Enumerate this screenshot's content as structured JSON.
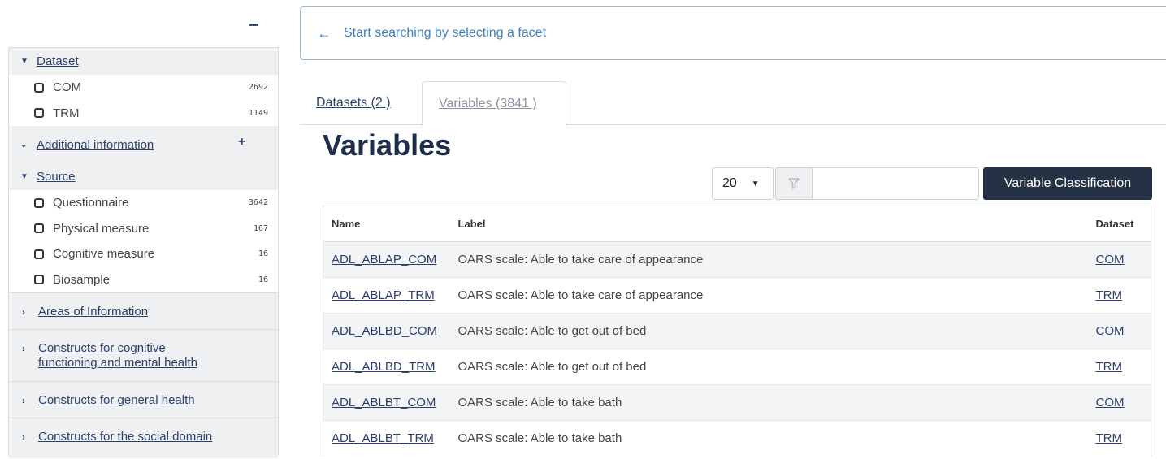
{
  "sidebar": {
    "collapse_symbol": "−",
    "sections": {
      "dataset": {
        "title": "Dataset",
        "items": [
          {
            "label": "COM",
            "count": "2692"
          },
          {
            "label": "TRM",
            "count": "1149"
          }
        ]
      },
      "additional_info": {
        "title": "Additional information",
        "plus": "+"
      },
      "source": {
        "title": "Source",
        "items": [
          {
            "label": "Questionnaire",
            "count": "3642"
          },
          {
            "label": "Physical measure",
            "count": "167"
          },
          {
            "label": "Cognitive measure",
            "count": "16"
          },
          {
            "label": "Biosample",
            "count": "16"
          }
        ]
      },
      "collapsed": [
        {
          "title": "Areas of Information"
        },
        {
          "title_line1": "Constructs for cognitive",
          "title_line2": "functioning and mental health"
        },
        {
          "title": "Constructs for general health"
        },
        {
          "title": "Constructs for the social domain"
        }
      ]
    }
  },
  "info_bar": {
    "text": "Start searching by selecting a facet"
  },
  "tabs": [
    {
      "label": "Datasets (2 )"
    },
    {
      "label": "Variables (3841 )"
    }
  ],
  "main": {
    "title": "Variables",
    "page_size": "20",
    "filter_placeholder": "",
    "classification_button": "Variable Classification",
    "table": {
      "headers": {
        "name": "Name",
        "label": "Label",
        "dataset": "Dataset"
      },
      "rows": [
        {
          "name": "ADL_ABLAP_COM",
          "label": "OARS scale: Able to take care of appearance",
          "dataset": "COM"
        },
        {
          "name": "ADL_ABLAP_TRM",
          "label": "OARS scale: Able to take care of appearance",
          "dataset": "TRM"
        },
        {
          "name": "ADL_ABLBD_COM",
          "label": "OARS scale: Able to get out of bed",
          "dataset": "COM"
        },
        {
          "name": "ADL_ABLBD_TRM",
          "label": "OARS scale: Able to get out of bed",
          "dataset": "TRM"
        },
        {
          "name": "ADL_ABLBT_COM",
          "label": "OARS scale: Able to take bath",
          "dataset": "COM"
        },
        {
          "name": "ADL_ABLBT_TRM",
          "label": "OARS scale: Able to take bath",
          "dataset": "TRM"
        }
      ]
    }
  },
  "icons": {
    "collapse": "minus-icon",
    "expanded_caret": "caret-down-icon",
    "collapsed_caret": "chevron-right-icon",
    "info_arrow": "arrow-left-icon",
    "filter": "filter-icon",
    "dropdown": "caret-down-icon"
  },
  "colors": {
    "primary": "#2c3e6b",
    "info": "#3d82bf",
    "button_bg": "#253246",
    "panel_bg": "#eef0f2"
  }
}
